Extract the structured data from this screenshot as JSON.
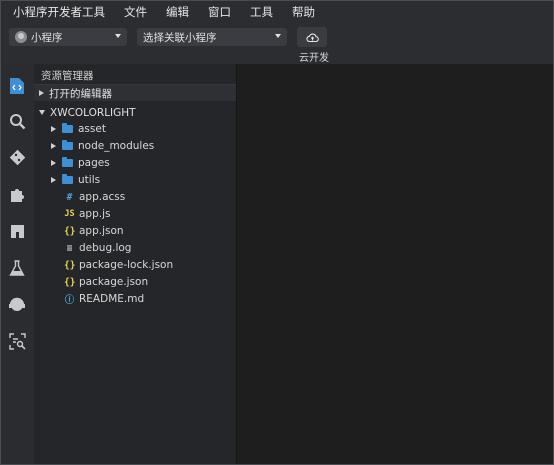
{
  "menubar": {
    "items": [
      "小程序开发者工具",
      "文件",
      "编辑",
      "窗口",
      "工具",
      "帮助"
    ]
  },
  "toolbar": {
    "mode_dropdown": {
      "value": "小程序"
    },
    "project_dropdown": {
      "value": "选择关联小程序"
    },
    "cloud_button": {
      "label": "云开发",
      "icon": "cloud-upload-icon"
    }
  },
  "activitybar": {
    "items": [
      "code-editor-icon",
      "search-icon",
      "git-icon",
      "extensions-icon",
      "bookmark-icon",
      "test-flask-icon",
      "remote-debug-icon",
      "code-scan-icon"
    ]
  },
  "sidebar": {
    "title": "资源管理器",
    "open_editors": "打开的编辑器",
    "workspace": "XWCOLORLIGHT",
    "folders": [
      "asset",
      "node_modules",
      "pages",
      "utils"
    ],
    "files": [
      {
        "icon": "#",
        "name": "app.acss"
      },
      {
        "icon": "JS",
        "name": "app.js"
      },
      {
        "icon": "{}",
        "name": "app.json"
      },
      {
        "icon": "≡",
        "name": "debug.log"
      },
      {
        "icon": "{}",
        "name": "package-lock.json"
      },
      {
        "icon": "{}",
        "name": "package.json"
      },
      {
        "icon": "ⓘ",
        "name": "README.md"
      }
    ]
  },
  "colors": {
    "accent": "#3d8fd6",
    "json_icon": "#e8d44d",
    "background": "#1e1e1e"
  }
}
